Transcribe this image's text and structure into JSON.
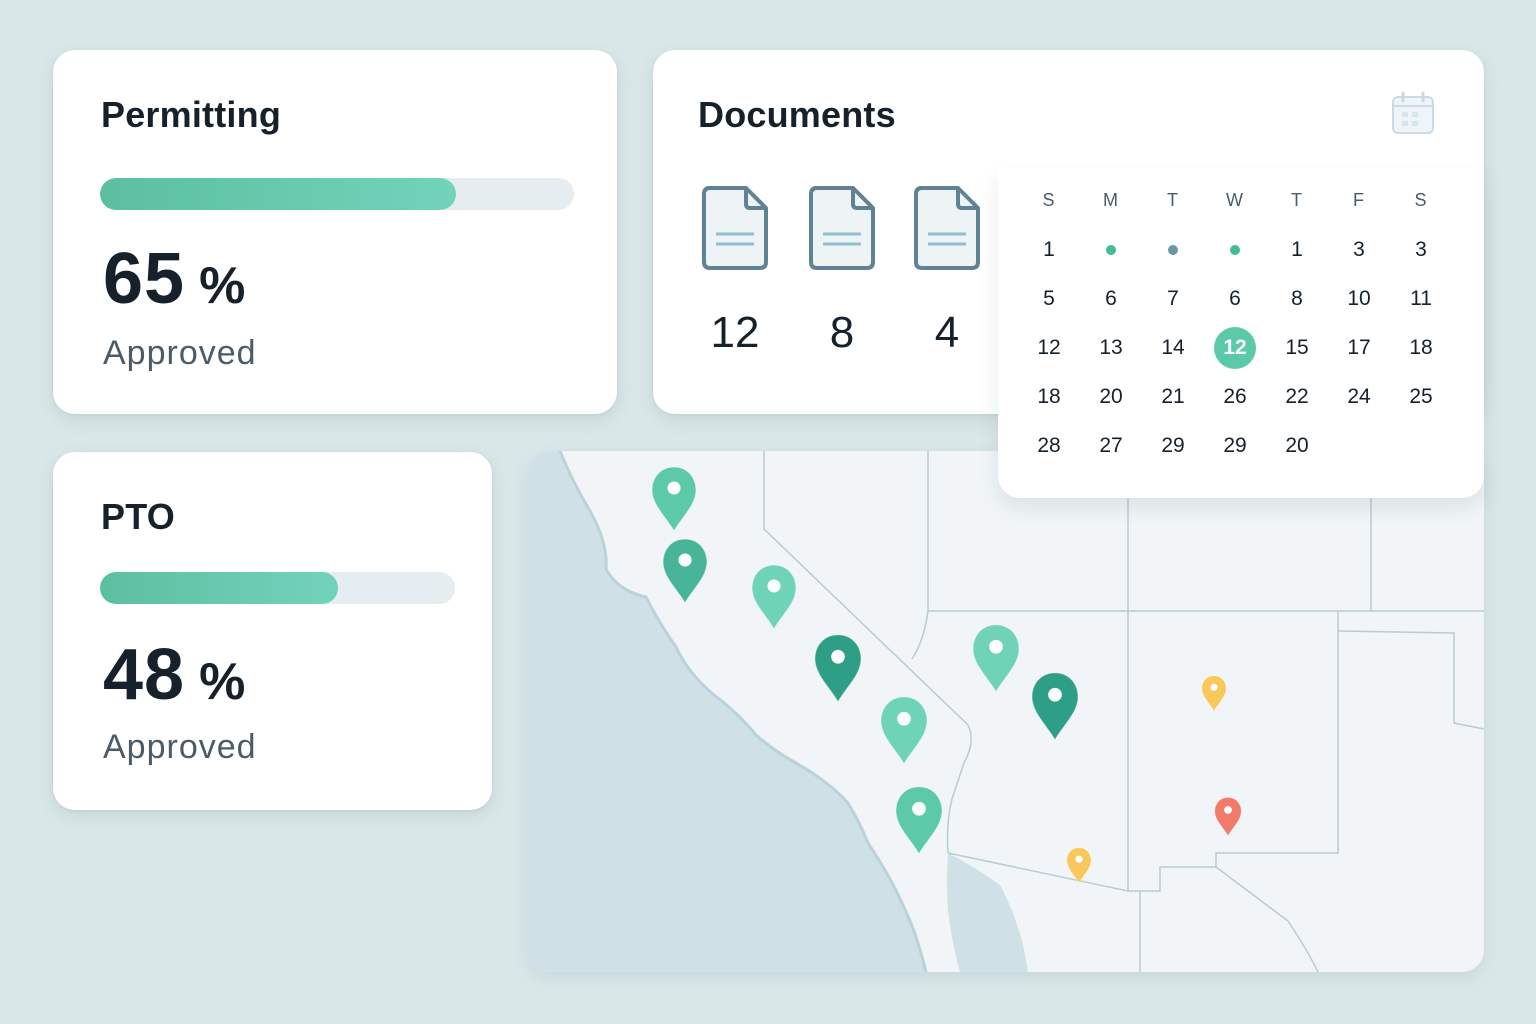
{
  "permitting": {
    "title": "Permitting",
    "progress": 0.75,
    "value": "65",
    "unit": "%",
    "label": "Approved"
  },
  "pto": {
    "title": "PTO",
    "progress": 0.67,
    "value": "48",
    "unit": "%",
    "label": "Approved"
  },
  "documents": {
    "title": "Documents",
    "icon": "calendar-icon",
    "items": [
      {
        "icon": "document-icon",
        "count": "12"
      },
      {
        "icon": "document-icon",
        "count": "8"
      },
      {
        "icon": "document-icon",
        "count": "4"
      }
    ]
  },
  "calendar": {
    "weekdays": [
      "S",
      "M",
      "T",
      "W",
      "T",
      "F",
      "S"
    ],
    "selected": "12",
    "weeks": [
      [
        "1",
        "dot",
        "dot",
        "dot",
        "1",
        "3",
        "3"
      ],
      [
        "5",
        "6",
        "7",
        "6",
        "8",
        "10",
        "11"
      ],
      [
        "12",
        "13",
        "14",
        "12",
        "15",
        "17",
        "18"
      ],
      [
        "18",
        "20",
        "21",
        "26",
        "22",
        "24",
        "25"
      ],
      [
        "28",
        "27",
        "29",
        "29",
        "20",
        "",
        ""
      ]
    ],
    "dot_colors": [
      "#3fbf93",
      "#6b97ab",
      "#3fbf93"
    ]
  },
  "map": {
    "markers": [
      {
        "color": "#5cc9a7"
      },
      {
        "color": "#49b598"
      },
      {
        "color": "#6fd3b8"
      },
      {
        "color": "#2f9e86"
      },
      {
        "color": "#6fd3b8"
      },
      {
        "color": "#5cc9a7"
      },
      {
        "color": "#6fd3b8"
      },
      {
        "color": "#2f9e86"
      },
      {
        "color": "#f8c95a"
      },
      {
        "color": "#f8c95a"
      },
      {
        "color": "#f27a6b"
      }
    ]
  }
}
